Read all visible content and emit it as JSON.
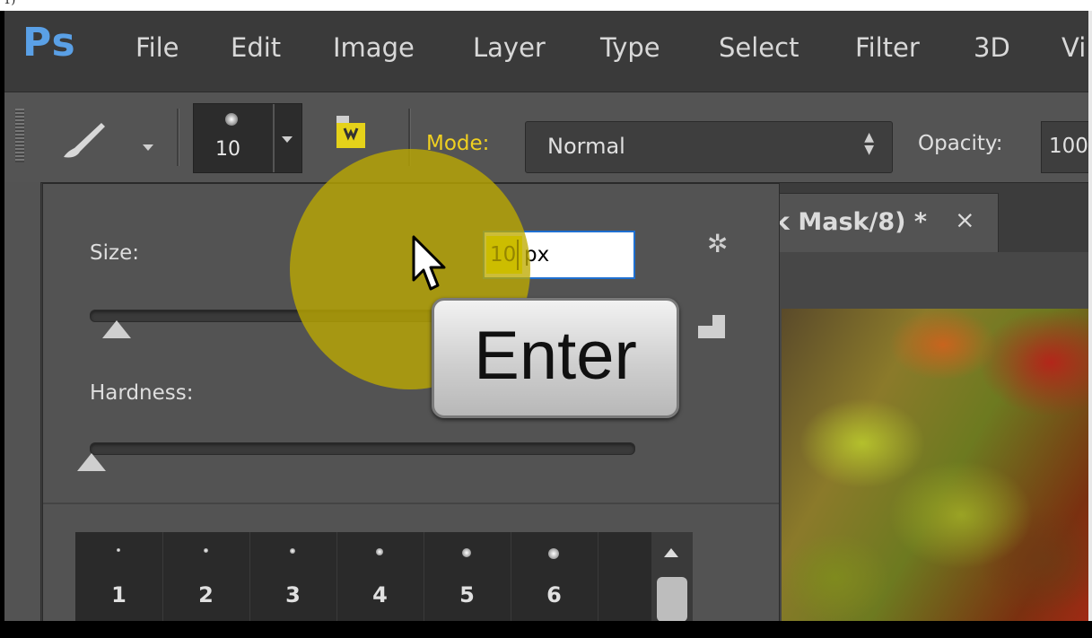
{
  "app": {
    "logo": "Ps"
  },
  "menu": [
    "File",
    "Edit",
    "Image",
    "Layer",
    "Type",
    "Select",
    "Filter",
    "3D",
    "Vi"
  ],
  "options_bar": {
    "brush_size": "10",
    "mode_label": "Mode:",
    "mode_value": "Normal",
    "opacity_label": "Opacity:",
    "opacity_value": "100"
  },
  "document_tab": {
    "title": "k Mask/8) *",
    "close": "×"
  },
  "brush_popup": {
    "size_label": "Size:",
    "size_value": "10",
    "size_unit": "px",
    "hardness_label": "Hardness:",
    "presets": [
      "1",
      "2",
      "3",
      "4",
      "5",
      "6"
    ]
  },
  "overlay": {
    "key_label": "Enter"
  },
  "colors": {
    "accent_yellow": "#f0d020",
    "ps_blue": "#5aa0e6",
    "click_highlight": "#beaa00"
  }
}
